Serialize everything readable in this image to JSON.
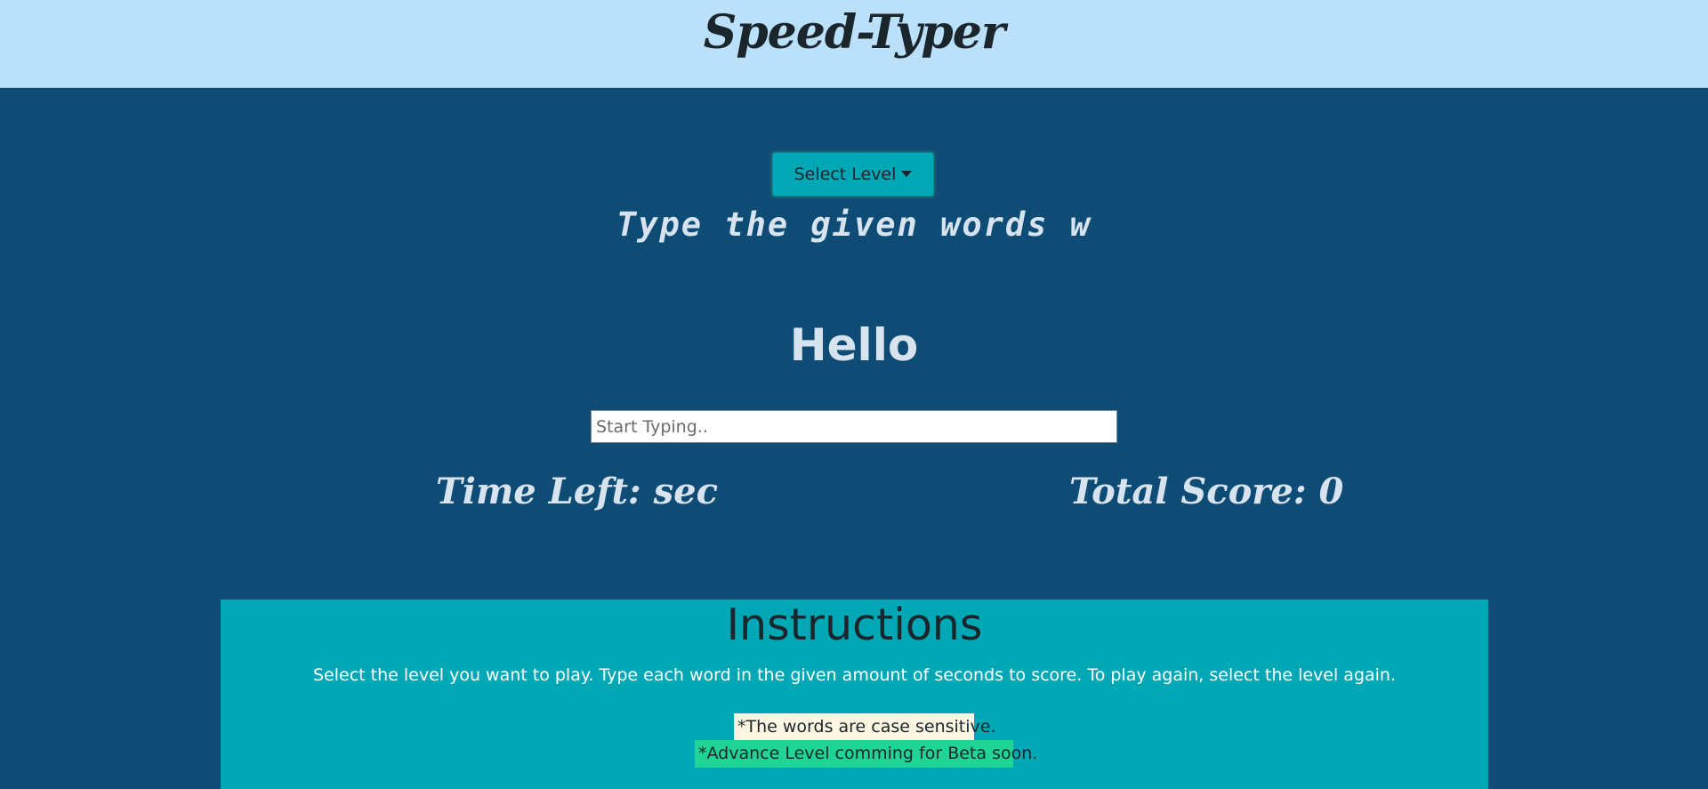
{
  "header": {
    "title": "Speed-Typer"
  },
  "controls": {
    "level_button_label": "Select Level",
    "marquee_text": "Type the given words w"
  },
  "game": {
    "current_word": "Hello",
    "input_placeholder": "Start Typing..",
    "input_value": "",
    "time_label": "Time Left:",
    "time_value": "",
    "time_unit": "sec",
    "score_label": "Total Score:",
    "score_value": "0"
  },
  "instructions": {
    "title": "Instructions",
    "text": "Select the level you want to play. Type each word in the given amount of seconds to score. To play again, select the level again.",
    "note_case": "*The words are case sensitive.",
    "note_beta": "*Advance Level comming for Beta soon."
  },
  "colors": {
    "header_bg": "#bbe1fa",
    "main_bg": "#0f4c75",
    "accent": "#00a8b5",
    "text_dark": "#1b262c",
    "text_light": "#d7e3ee",
    "note_case_bg": "#fdf6e3",
    "note_beta_bg": "#1fd494"
  }
}
